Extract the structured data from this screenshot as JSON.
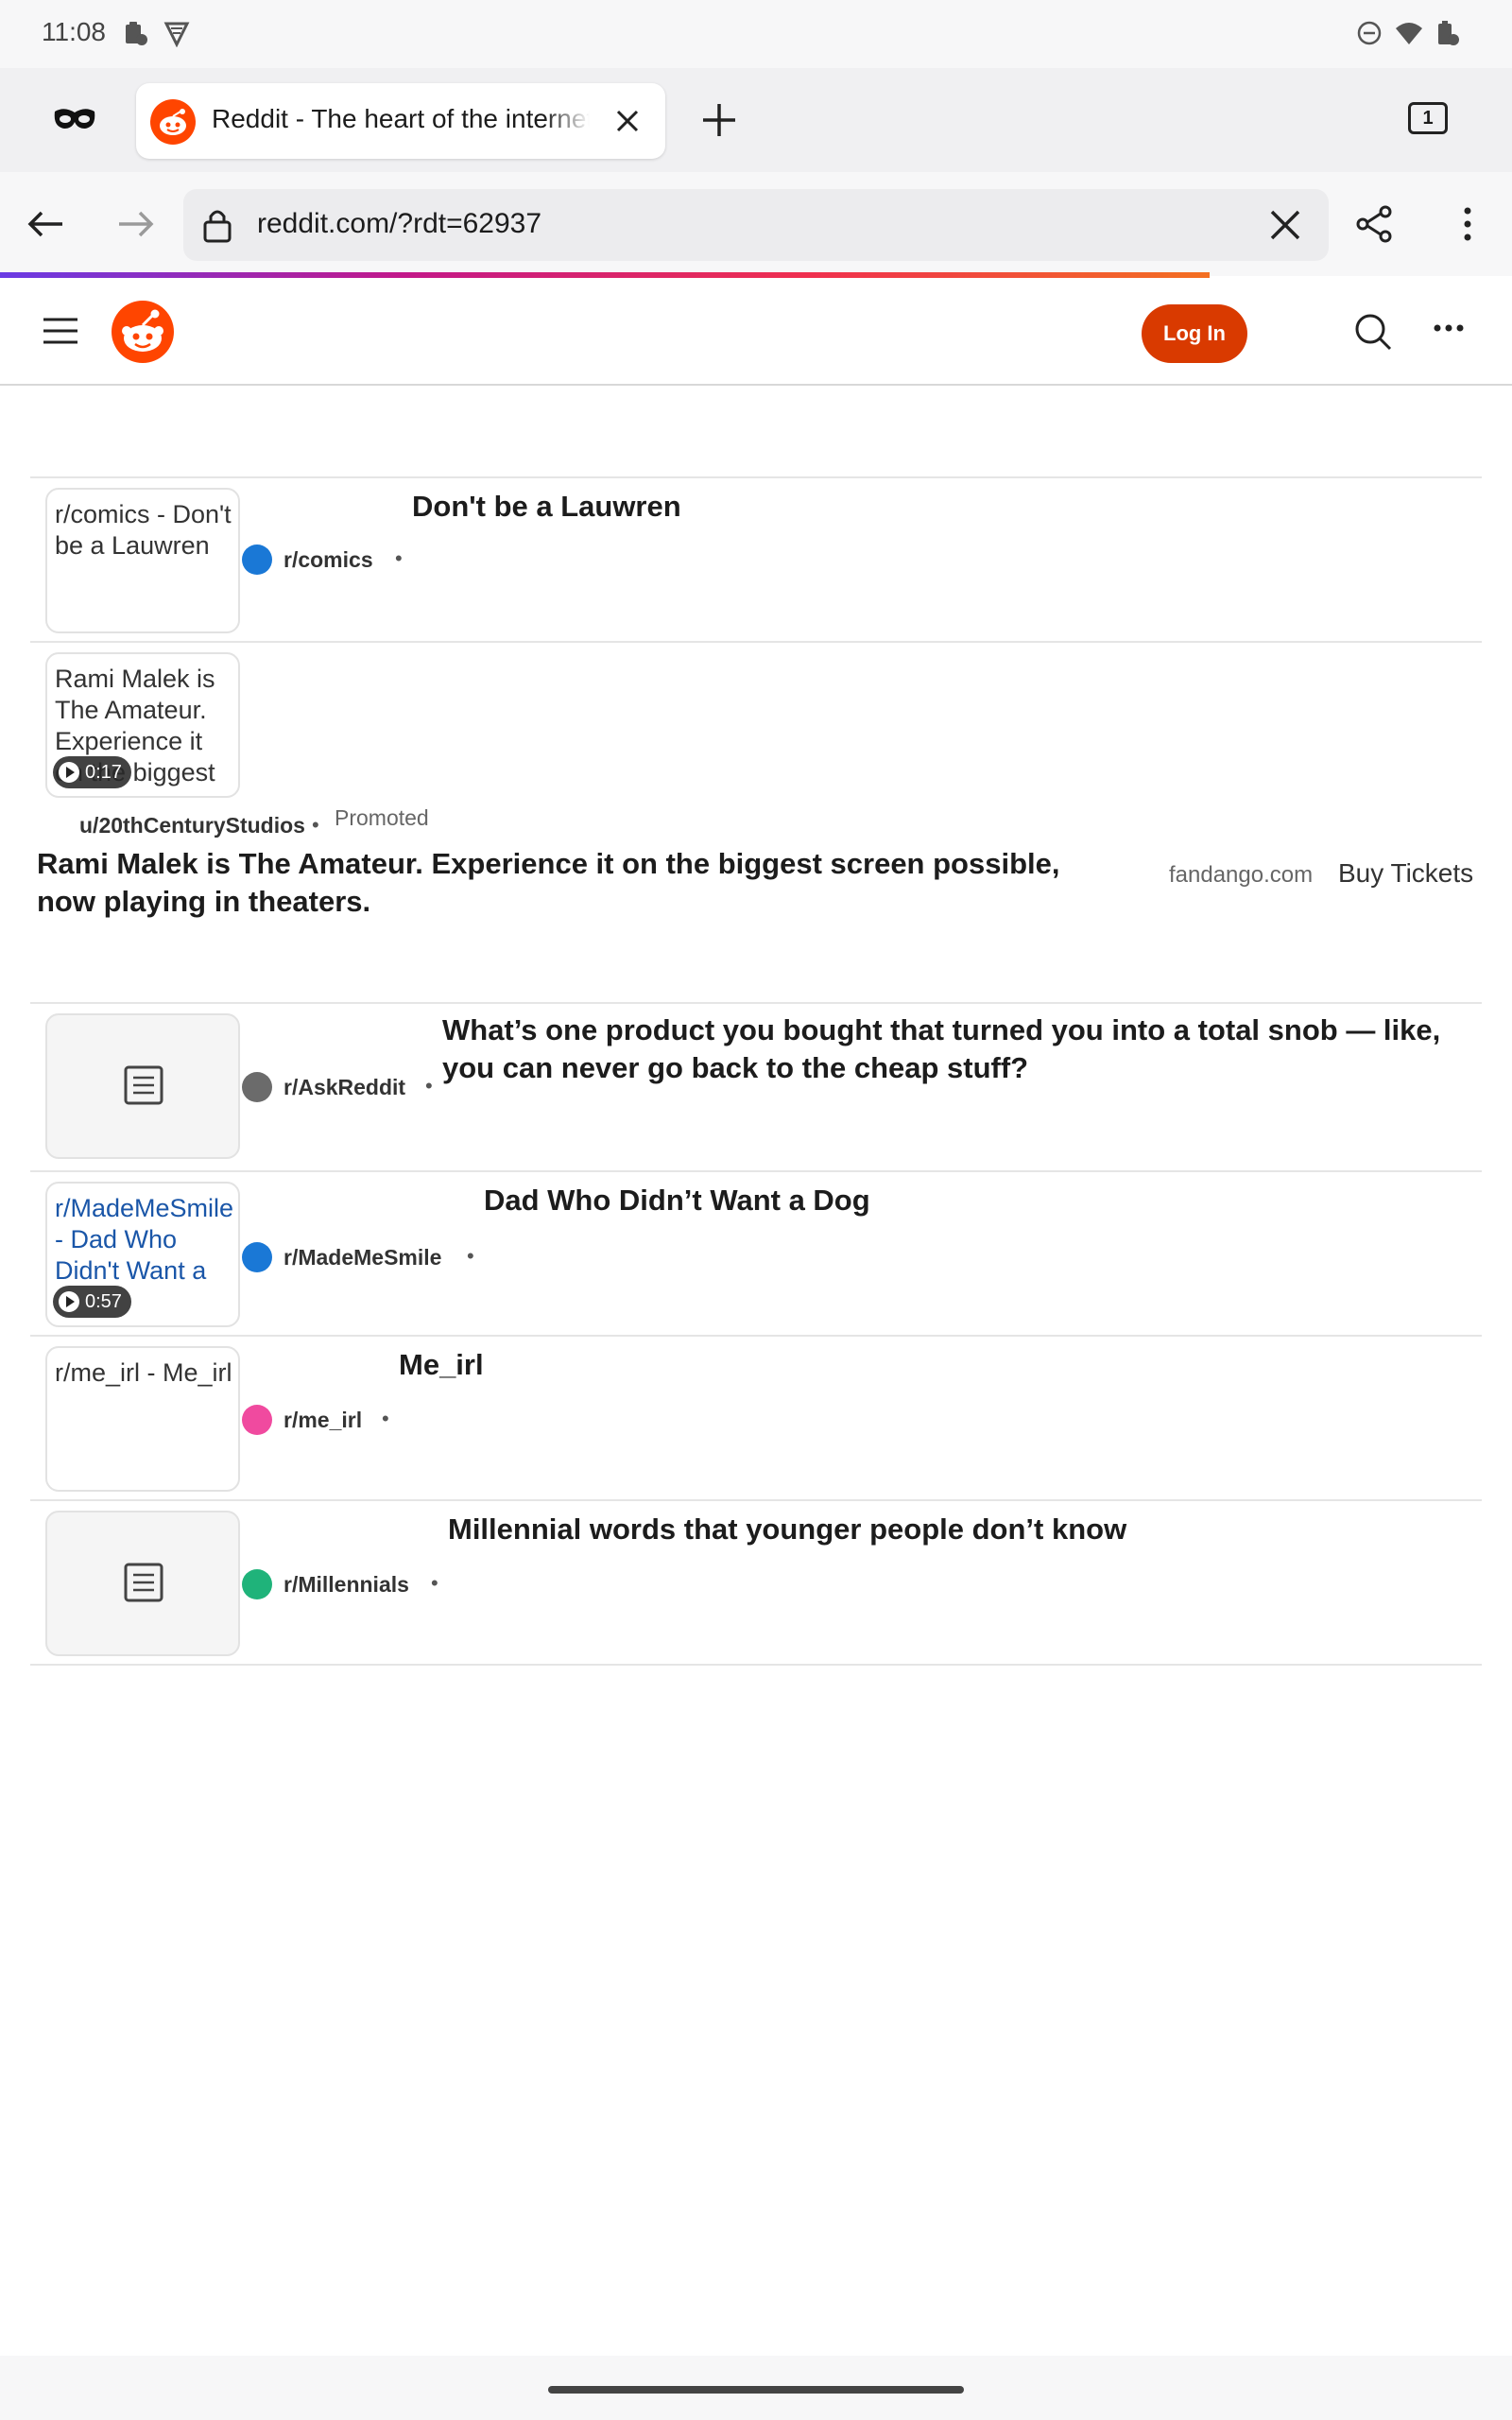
{
  "status_bar": {
    "time": "11:08",
    "left_icons": [
      "clipboard-icon",
      "shield-vpn-icon"
    ],
    "right_icons": [
      "do-not-disturb-icon",
      "wifi-icon",
      "battery-icon"
    ]
  },
  "browser": {
    "private_icon": "incognito-mask-icon",
    "tab": {
      "title": "Reddit - The heart of the internet",
      "favicon": "reddit-icon"
    },
    "tab_count": "1",
    "url": "reddit.com/?rdt=62937"
  },
  "reddit_header": {
    "login_label": "Log In"
  },
  "posts": [
    {
      "thumb_alt": "r/comics - Don't be a Lauwren",
      "subreddit": "r/comics",
      "dot_color": "#1a78d6",
      "separator": "•",
      "title": "Don't be a Lauwren"
    },
    {
      "thumb_alt": "Rami Malek is The Amateur. Experience it on the biggest",
      "video_duration": "0:17",
      "user": "u/20thCenturyStudios",
      "separator": "•",
      "promoted_label": "Promoted",
      "title": "Rami Malek is The Amateur. Experience it on the biggest screen possible, now playing in theaters.",
      "domain": "fandango.com",
      "cta": "Buy Tickets"
    },
    {
      "subreddit": "r/AskReddit",
      "dot_color": "#6b6b6b",
      "separator": "•",
      "title": "What’s one product you bought that turned you into a total snob — like, you can never go back to the cheap stuff?"
    },
    {
      "thumb_alt": "r/MadeMeSmile - Dad Who Didn't Want a",
      "video_duration": "0:57",
      "subreddit": "r/MadeMeSmile",
      "dot_color": "#1a78d6",
      "separator": "•",
      "title": "Dad Who Didn’t Want a Dog"
    },
    {
      "thumb_alt": "r/me_irl - Me_irl",
      "subreddit": "r/me_irl",
      "dot_color": "#f04a9f",
      "separator": "•",
      "title": "Me_irl"
    },
    {
      "subreddit": "r/Millennials",
      "dot_color": "#1fb37a",
      "separator": "•",
      "title": "Millennial words that younger people don’t know"
    }
  ],
  "colors": {
    "reddit_orange": "#ff4500",
    "login_button": "#d93a00"
  }
}
